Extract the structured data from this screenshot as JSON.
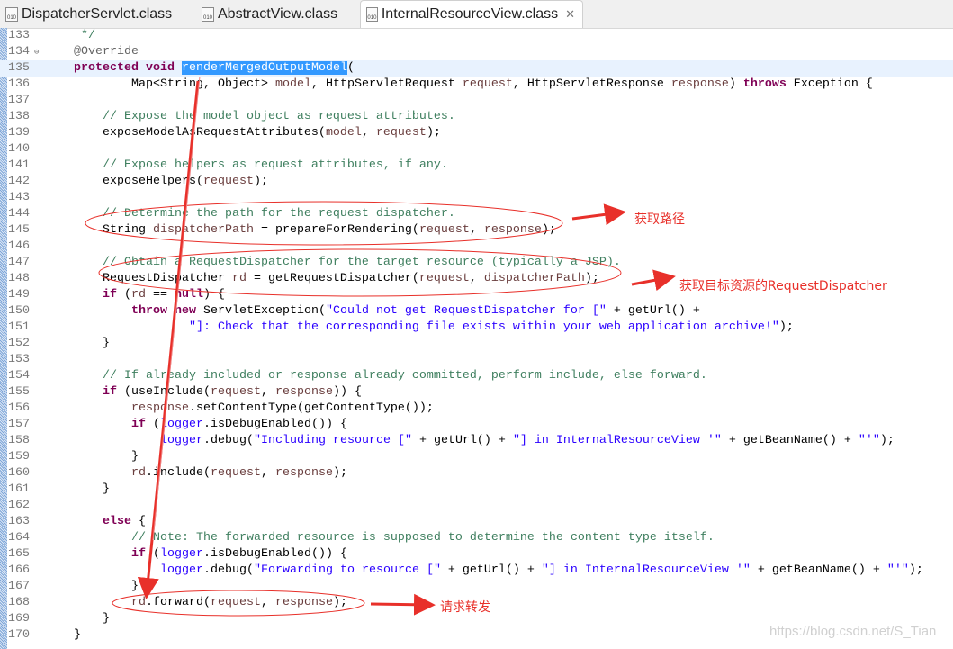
{
  "tabs": [
    {
      "label": "DispatcherServlet.class",
      "active": false
    },
    {
      "label": "AbstractView.class",
      "active": false
    },
    {
      "label": "InternalResourceView.class",
      "active": true
    }
  ],
  "close_glyph": "✕",
  "file_icon": "class-file-icon",
  "colors": {
    "keyword": "#7f0055",
    "string": "#2a00ff",
    "comment": "#3f7f5f",
    "annotation_red": "#e8302a",
    "selection": "#3399ff"
  },
  "lines": [
    {
      "n": "133",
      "t": [
        [
          "cm",
          "     */"
        ]
      ]
    },
    {
      "n": "134",
      "fold": "⊖",
      "t": [
        [
          "ann",
          "    @Override"
        ]
      ]
    },
    {
      "n": "135",
      "cur": true,
      "t": [
        [
          "",
          "    "
        ],
        [
          "kw",
          "protected"
        ],
        [
          "",
          " "
        ],
        [
          "kw",
          "void"
        ],
        [
          "",
          " "
        ],
        [
          "sel",
          "renderMergedOutputModel"
        ],
        [
          "",
          "("
        ]
      ]
    },
    {
      "n": "136",
      "t": [
        [
          "",
          "            Map<String, Object> "
        ],
        [
          "var",
          "model"
        ],
        [
          "",
          ", HttpServletRequest "
        ],
        [
          "var",
          "request"
        ],
        [
          "",
          ", HttpServletResponse "
        ],
        [
          "var",
          "response"
        ],
        [
          "",
          ") "
        ],
        [
          "kw",
          "throws"
        ],
        [
          "",
          " Exception {"
        ]
      ]
    },
    {
      "n": "137",
      "t": []
    },
    {
      "n": "138",
      "t": [
        [
          "cm",
          "        // Expose the model object as request attributes."
        ]
      ]
    },
    {
      "n": "139",
      "t": [
        [
          "",
          "        exposeModelAsRequestAttributes("
        ],
        [
          "var",
          "model"
        ],
        [
          "",
          ", "
        ],
        [
          "var",
          "request"
        ],
        [
          "",
          ");"
        ]
      ]
    },
    {
      "n": "140",
      "t": []
    },
    {
      "n": "141",
      "t": [
        [
          "cm",
          "        // Expose helpers as request attributes, if any."
        ]
      ]
    },
    {
      "n": "142",
      "t": [
        [
          "",
          "        exposeHelpers("
        ],
        [
          "var",
          "request"
        ],
        [
          "",
          ");"
        ]
      ]
    },
    {
      "n": "143",
      "t": []
    },
    {
      "n": "144",
      "t": [
        [
          "cm",
          "        // Determine the path for the request dispatcher."
        ]
      ]
    },
    {
      "n": "145",
      "t": [
        [
          "",
          "        String "
        ],
        [
          "var",
          "dispatcherPath"
        ],
        [
          "",
          " = prepareForRendering("
        ],
        [
          "var",
          "request"
        ],
        [
          "",
          ", "
        ],
        [
          "var",
          "response"
        ],
        [
          "",
          ");"
        ]
      ]
    },
    {
      "n": "146",
      "t": []
    },
    {
      "n": "147",
      "t": [
        [
          "cm",
          "        // Obtain a RequestDispatcher for the target resource (typically a JSP)."
        ]
      ]
    },
    {
      "n": "148",
      "t": [
        [
          "",
          "        RequestDispatcher "
        ],
        [
          "var",
          "rd"
        ],
        [
          "",
          " = getRequestDispatcher("
        ],
        [
          "var",
          "request"
        ],
        [
          "",
          ", "
        ],
        [
          "var",
          "dispatcherPath"
        ],
        [
          "",
          ");"
        ]
      ]
    },
    {
      "n": "149",
      "t": [
        [
          "",
          "        "
        ],
        [
          "kw",
          "if"
        ],
        [
          "",
          " ("
        ],
        [
          "var",
          "rd"
        ],
        [
          "",
          " == "
        ],
        [
          "kw",
          "null"
        ],
        [
          "",
          ") {"
        ]
      ]
    },
    {
      "n": "150",
      "t": [
        [
          "",
          "            "
        ],
        [
          "kw",
          "throw"
        ],
        [
          "",
          " "
        ],
        [
          "kw",
          "new"
        ],
        [
          "",
          " ServletException("
        ],
        [
          "str",
          "\"Could not get RequestDispatcher for [\""
        ],
        [
          "",
          " + getUrl() +"
        ]
      ]
    },
    {
      "n": "151",
      "t": [
        [
          "",
          "                    "
        ],
        [
          "str",
          "\"]: Check that the corresponding file exists within your web application archive!\""
        ],
        [
          "",
          ");"
        ]
      ]
    },
    {
      "n": "152",
      "t": [
        [
          "",
          "        }"
        ]
      ]
    },
    {
      "n": "153",
      "t": []
    },
    {
      "n": "154",
      "t": [
        [
          "cm",
          "        // If already included or response already committed, perform include, else forward."
        ]
      ]
    },
    {
      "n": "155",
      "t": [
        [
          "",
          "        "
        ],
        [
          "kw",
          "if"
        ],
        [
          "",
          " (useInclude("
        ],
        [
          "var",
          "request"
        ],
        [
          "",
          ", "
        ],
        [
          "var",
          "response"
        ],
        [
          "",
          ")) {"
        ]
      ]
    },
    {
      "n": "156",
      "t": [
        [
          "",
          "            "
        ],
        [
          "var",
          "response"
        ],
        [
          "",
          ".setContentType(getContentType());"
        ]
      ]
    },
    {
      "n": "157",
      "t": [
        [
          "",
          "            "
        ],
        [
          "kw",
          "if"
        ],
        [
          "",
          " ("
        ],
        [
          "str",
          "logger"
        ],
        [
          "",
          ".isDebugEnabled()) {"
        ]
      ]
    },
    {
      "n": "158",
      "t": [
        [
          "",
          "                "
        ],
        [
          "str",
          "logger"
        ],
        [
          "",
          ".debug("
        ],
        [
          "str",
          "\"Including resource [\""
        ],
        [
          "",
          " + getUrl() + "
        ],
        [
          "str",
          "\"] in InternalResourceView '\""
        ],
        [
          "",
          " + getBeanName() + "
        ],
        [
          "str",
          "\"'\""
        ],
        [
          "",
          ");"
        ]
      ]
    },
    {
      "n": "159",
      "t": [
        [
          "",
          "            }"
        ]
      ]
    },
    {
      "n": "160",
      "t": [
        [
          "",
          "            "
        ],
        [
          "var",
          "rd"
        ],
        [
          "",
          ".include("
        ],
        [
          "var",
          "request"
        ],
        [
          "",
          ", "
        ],
        [
          "var",
          "response"
        ],
        [
          "",
          ");"
        ]
      ]
    },
    {
      "n": "161",
      "t": [
        [
          "",
          "        }"
        ]
      ]
    },
    {
      "n": "162",
      "t": []
    },
    {
      "n": "163",
      "t": [
        [
          "",
          "        "
        ],
        [
          "kw",
          "else"
        ],
        [
          "",
          " {"
        ]
      ]
    },
    {
      "n": "164",
      "t": [
        [
          "cm",
          "            // Note: The forwarded resource is supposed to determine the content type itself."
        ]
      ]
    },
    {
      "n": "165",
      "t": [
        [
          "",
          "            "
        ],
        [
          "kw",
          "if"
        ],
        [
          "",
          " ("
        ],
        [
          "str",
          "logger"
        ],
        [
          "",
          ".isDebugEnabled()) {"
        ]
      ]
    },
    {
      "n": "166",
      "t": [
        [
          "",
          "                "
        ],
        [
          "str",
          "logger"
        ],
        [
          "",
          ".debug("
        ],
        [
          "str",
          "\"Forwarding to resource [\""
        ],
        [
          "",
          " + getUrl() + "
        ],
        [
          "str",
          "\"] in InternalResourceView '\""
        ],
        [
          "",
          " + getBeanName() + "
        ],
        [
          "str",
          "\"'\""
        ],
        [
          "",
          ");"
        ]
      ]
    },
    {
      "n": "167",
      "t": [
        [
          "",
          "            }"
        ]
      ]
    },
    {
      "n": "168",
      "t": [
        [
          "",
          "            "
        ],
        [
          "var",
          "rd"
        ],
        [
          "",
          ".forward("
        ],
        [
          "var",
          "request"
        ],
        [
          "",
          ", "
        ],
        [
          "var",
          "response"
        ],
        [
          "",
          ");"
        ]
      ]
    },
    {
      "n": "169",
      "t": [
        [
          "",
          "        }"
        ]
      ]
    },
    {
      "n": "170",
      "t": [
        [
          "",
          "    }"
        ]
      ]
    }
  ],
  "annotations": {
    "path": "获取路径",
    "dispatcher": "获取目标资源的RequestDispatcher",
    "forward": "请求转发"
  },
  "watermark": "https://blog.csdn.net/S_Tian"
}
